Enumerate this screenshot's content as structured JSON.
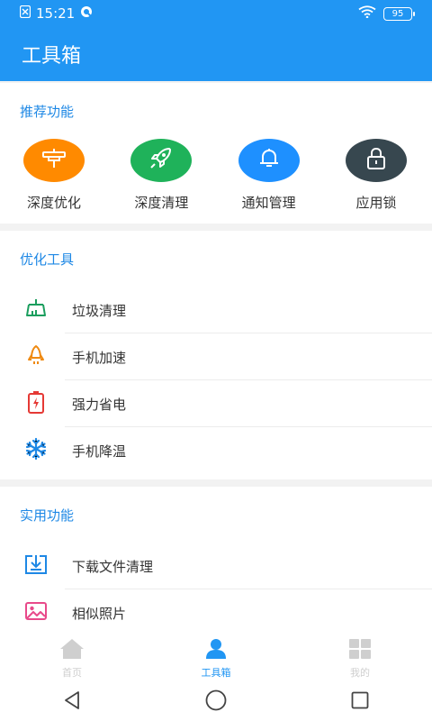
{
  "status": {
    "time": "15:21",
    "battery": "95"
  },
  "app_bar": {
    "title": "工具箱"
  },
  "recommended": {
    "title": "推荐功能",
    "items": [
      {
        "label": "深度优化",
        "color": "#ff8a00",
        "icon": "sign-icon"
      },
      {
        "label": "深度清理",
        "color": "#1fb25a",
        "icon": "rocket-icon"
      },
      {
        "label": "通知管理",
        "color": "#1e90ff",
        "icon": "bell-icon"
      },
      {
        "label": "应用锁",
        "color": "#37474f",
        "icon": "lock-icon"
      }
    ]
  },
  "optimize_tools": {
    "title": "优化工具",
    "items": [
      {
        "label": "垃圾清理",
        "icon": "broom-icon"
      },
      {
        "label": "手机加速",
        "icon": "rocket-icon"
      },
      {
        "label": "强力省电",
        "icon": "battery-icon"
      },
      {
        "label": "手机降温",
        "icon": "snowflake-icon"
      }
    ]
  },
  "utility": {
    "title": "实用功能",
    "items": [
      {
        "label": "下载文件清理",
        "icon": "download-icon"
      },
      {
        "label": "相似照片",
        "icon": "image-icon"
      }
    ]
  },
  "bottom_nav": {
    "items": [
      {
        "label": "首页",
        "icon": "home-icon",
        "active": false
      },
      {
        "label": "工具箱",
        "icon": "person-icon",
        "active": true
      },
      {
        "label": "我的",
        "icon": "grid-icon",
        "active": false
      }
    ]
  },
  "colors": {
    "primary": "#2196f3",
    "section_title": "#1e88e5",
    "inactive_nav": "#cfcfcf"
  }
}
